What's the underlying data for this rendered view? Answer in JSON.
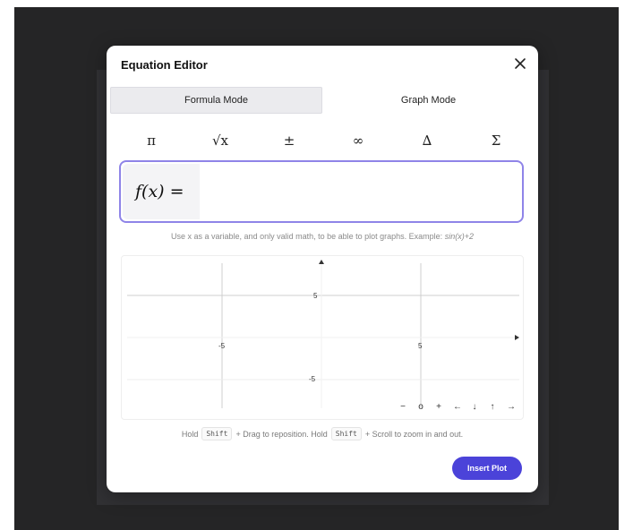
{
  "dialog": {
    "title": "Equation Editor",
    "close_icon": "close-icon"
  },
  "tabs": [
    {
      "label": "Formula Mode",
      "active": true
    },
    {
      "label": "Graph Mode",
      "active": false
    }
  ],
  "symbols": [
    "π",
    "√x",
    "±",
    "∞",
    "∆",
    "Σ"
  ],
  "formula": {
    "label": "f(x) =",
    "value": "",
    "placeholder": ""
  },
  "hint": {
    "text": "Use x as a variable, and only valid math, to be able to plot graphs. Example:",
    "example": "sin(x)+2"
  },
  "graph": {
    "x_ticks": [
      "-5",
      "5"
    ],
    "y_ticks": [
      "5",
      "-5"
    ],
    "toolbar": [
      "−",
      "o",
      "+",
      "←",
      "↓",
      "↑",
      "→"
    ]
  },
  "help": {
    "part1": "Hold",
    "key1": "Shift",
    "part2": "+ Drag to reposition. Hold",
    "key2": "Shift",
    "part3": "+ Scroll to zoom in and out."
  },
  "insert_button": {
    "label": "Insert Plot",
    "color": "#4b43d9"
  },
  "colors": {
    "accent": "#8f84e8",
    "backdrop": "#252526"
  }
}
